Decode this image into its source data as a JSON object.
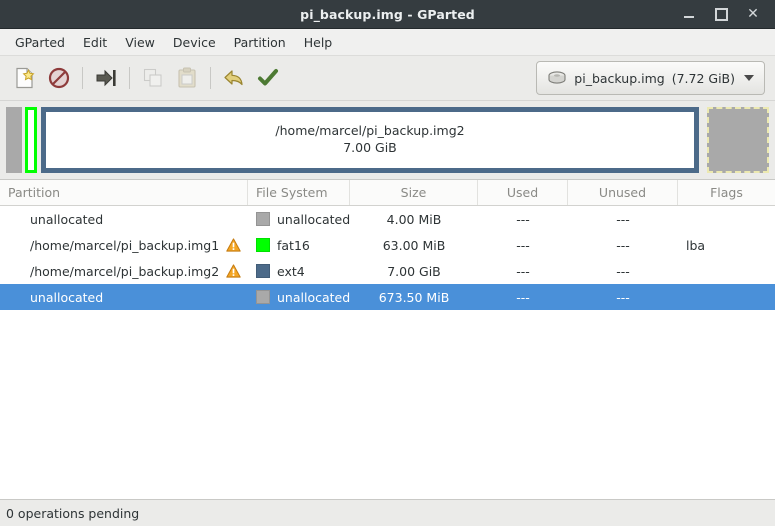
{
  "window": {
    "title": "pi_backup.img - GParted",
    "controls": [
      {
        "name": "minimize",
        "glyph": "minimize-icon"
      },
      {
        "name": "maximize",
        "glyph": "maximize-icon"
      },
      {
        "name": "close",
        "glyph": "close-icon",
        "label": "✕"
      }
    ]
  },
  "menubar": {
    "items": [
      {
        "label": "GParted"
      },
      {
        "label": "Edit"
      },
      {
        "label": "View"
      },
      {
        "label": "Device"
      },
      {
        "label": "Partition"
      },
      {
        "label": "Help"
      }
    ]
  },
  "toolbar": {
    "buttons": [
      {
        "name": "new-partition-button",
        "icon": "new-document-icon",
        "enabled": true
      },
      {
        "name": "delete-partition-button",
        "icon": "delete-forbidden-icon",
        "enabled": true
      },
      {
        "name": "resize-move-button",
        "icon": "resize-move-arrow-icon",
        "enabled": true
      },
      {
        "name": "copy-button",
        "icon": "copy-icon",
        "enabled": false
      },
      {
        "name": "paste-button",
        "icon": "paste-clipboard-icon",
        "enabled": false
      },
      {
        "name": "undo-button",
        "icon": "undo-arrow-icon",
        "enabled": true
      },
      {
        "name": "apply-button",
        "icon": "apply-check-icon",
        "enabled": true
      }
    ],
    "device_selector": {
      "icon": "hard-disk-icon",
      "name": "pi_backup.img",
      "size": "(7.72 GiB)"
    }
  },
  "diskview": {
    "blocks": [
      {
        "name": "unallocated-lead",
        "type": "unallocated"
      },
      {
        "name": "fat16-partition",
        "type": "fat16"
      },
      {
        "name": "ext4-partition",
        "type": "ext4",
        "label": "/home/marcel/pi_backup.img2",
        "size": "7.00 GiB"
      },
      {
        "name": "unallocated-tail",
        "type": "unallocated",
        "selected": true
      }
    ]
  },
  "table": {
    "headers": [
      {
        "label": "Partition"
      },
      {
        "label": "File System"
      },
      {
        "label": "Size"
      },
      {
        "label": "Used"
      },
      {
        "label": "Unused"
      },
      {
        "label": "Flags"
      }
    ],
    "rows": [
      {
        "partition": "unallocated",
        "warning": false,
        "fs": "unallocated",
        "fs_color": "#a9a9a9",
        "size": "4.00 MiB",
        "used": "---",
        "unused": "---",
        "flags": ""
      },
      {
        "partition": "/home/marcel/pi_backup.img1",
        "warning": true,
        "fs": "fat16",
        "fs_color": "#00ff00",
        "size": "63.00 MiB",
        "used": "---",
        "unused": "---",
        "flags": "lba"
      },
      {
        "partition": "/home/marcel/pi_backup.img2",
        "warning": true,
        "fs": "ext4",
        "fs_color": "#4c6a89",
        "size": "7.00 GiB",
        "used": "---",
        "unused": "---",
        "flags": ""
      },
      {
        "partition": "unallocated",
        "warning": false,
        "fs": "unallocated",
        "fs_color": "#a9a9a9",
        "size": "673.50 MiB",
        "used": "---",
        "unused": "---",
        "flags": "",
        "selected": true
      }
    ]
  },
  "statusbar": {
    "text": "0 operations pending"
  },
  "colors": {
    "titlebar": "#353c40",
    "selection": "#4a90d9",
    "unallocated": "#a9a9a9",
    "fat16": "#00ff00",
    "ext4": "#4c6a89",
    "chrome": "#ebebe9"
  }
}
